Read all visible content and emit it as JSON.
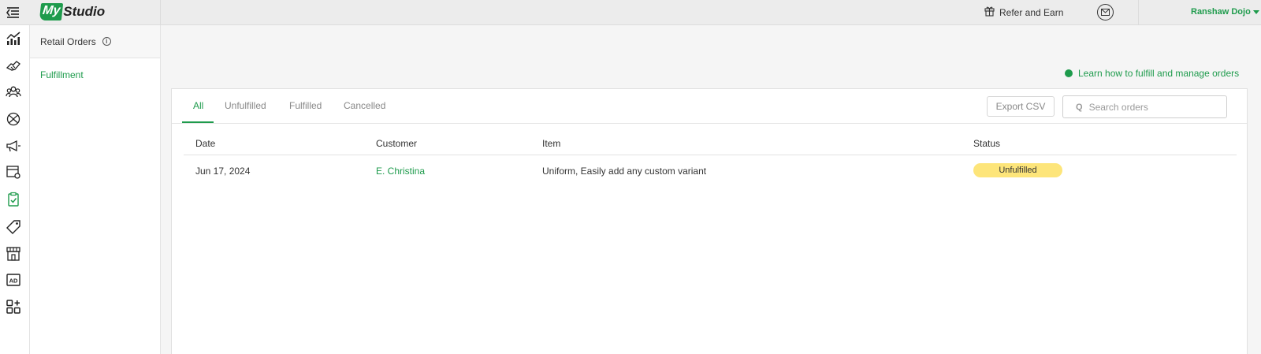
{
  "header": {
    "logo_my": "My",
    "logo_studio": "Studio",
    "refer_label": "Refer and Earn",
    "account_name": "Ranshaw Dojo"
  },
  "rail": {
    "icons": [
      "menu-icon",
      "analytics-icon",
      "handshake-icon",
      "members-icon",
      "programs-icon",
      "megaphone-icon",
      "schedule-settings-icon",
      "retail-orders-icon",
      "tag-icon",
      "storefront-icon",
      "ad-icon",
      "add-apps-icon"
    ]
  },
  "subnav": {
    "title": "Retail Orders",
    "info": "i",
    "items": [
      {
        "label": "Fulfillment"
      }
    ]
  },
  "main": {
    "learn_link": "Learn how to fulfill and manage orders",
    "tabs": [
      {
        "label": "All",
        "active": true
      },
      {
        "label": "Unfulfilled",
        "active": false
      },
      {
        "label": "Fulfilled",
        "active": false
      },
      {
        "label": "Cancelled",
        "active": false
      }
    ],
    "export_label": "Export CSV",
    "search": {
      "icon_glyph": "Q",
      "placeholder": "Search orders",
      "value": ""
    },
    "table": {
      "columns": [
        "Date",
        "Customer",
        "Item",
        "Status"
      ],
      "rows": [
        {
          "date": "Jun 17, 2024",
          "customer": "E. Christina",
          "item": "Uniform, Easily add any custom variant",
          "status": "Unfulfilled"
        }
      ]
    }
  },
  "colors": {
    "accent": "#1e9b4c",
    "status_unfulfilled": "#fde57a"
  }
}
